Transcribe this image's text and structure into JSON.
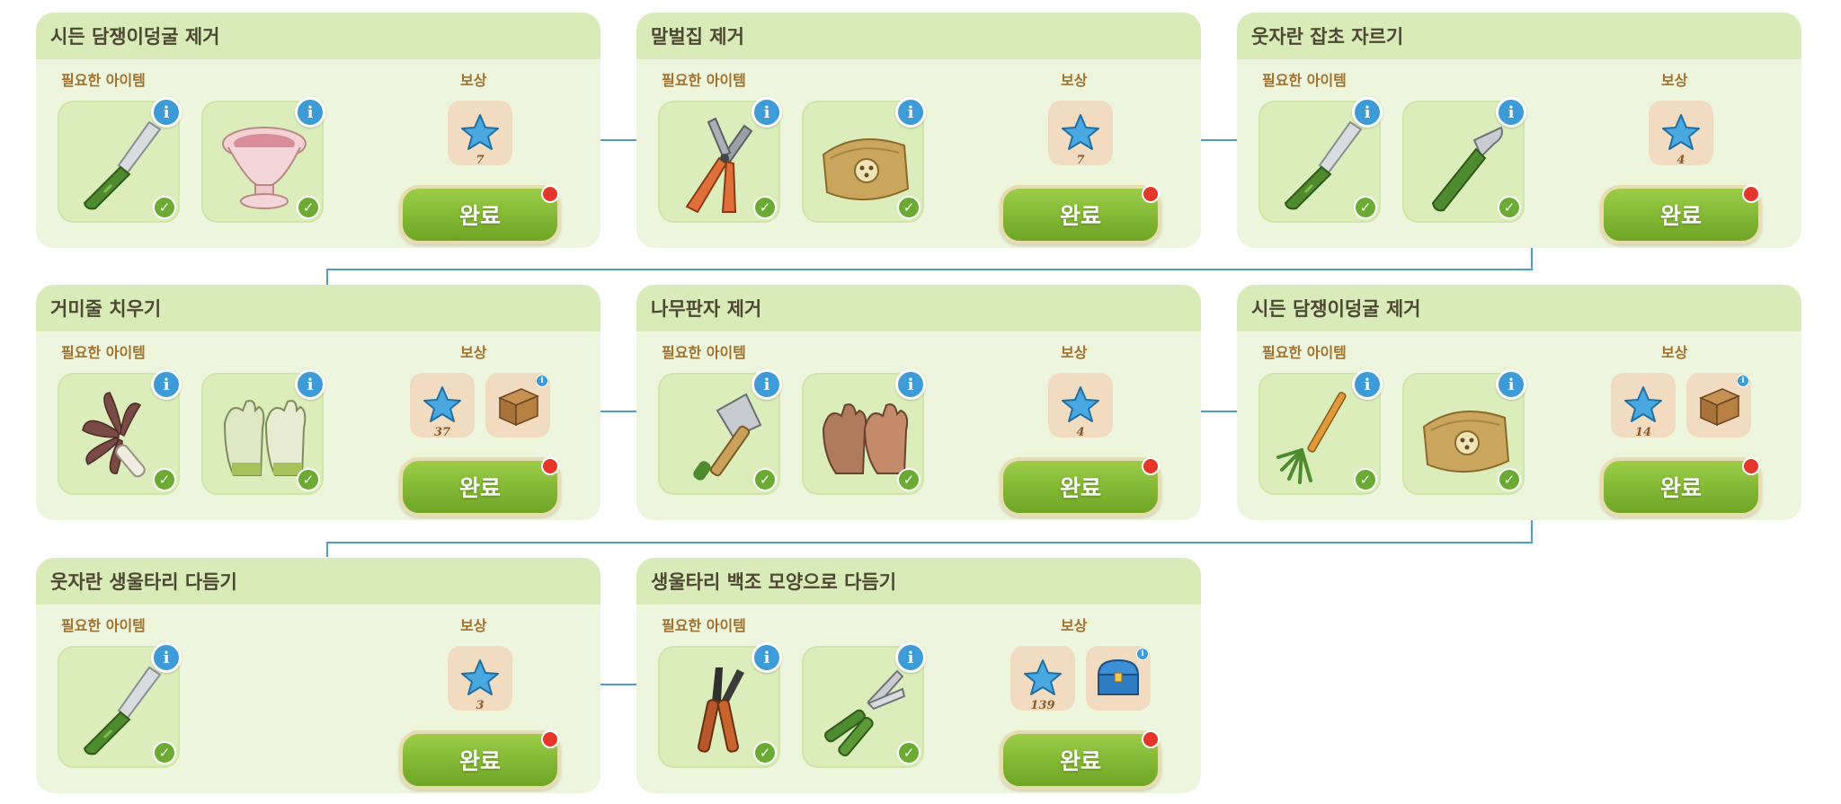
{
  "labels": {
    "required_items": "필요한 아이템",
    "reward": "보상",
    "complete_button": "완료",
    "info_symbol": "i",
    "check_symbol": "✓"
  },
  "colors": {
    "card_background": "#eef5dd",
    "card_header": "#d9ebb8",
    "button_green": "#7fb832",
    "notification_red": "#e5362a",
    "info_blue": "#3d9bd8",
    "connector_blue": "#4f9ccf"
  },
  "tasks": [
    {
      "title": "시든 담쟁이덩굴 제거",
      "items": [
        {
          "icon": "knife-icon"
        },
        {
          "icon": "pink-vase-icon"
        }
      ],
      "rewards": [
        {
          "icon": "blue-star-icon",
          "count": "7"
        }
      ]
    },
    {
      "title": "말벌집 제거",
      "items": [
        {
          "icon": "pliers-icon"
        },
        {
          "icon": "cloth-bag-icon"
        }
      ],
      "rewards": [
        {
          "icon": "blue-star-icon",
          "count": "7"
        }
      ]
    },
    {
      "title": "웃자란 잡초 자르기",
      "items": [
        {
          "icon": "knife-icon"
        },
        {
          "icon": "hook-knife-icon"
        }
      ],
      "rewards": [
        {
          "icon": "blue-star-icon",
          "count": "4"
        }
      ]
    },
    {
      "title": "거미줄 치우기",
      "items": [
        {
          "icon": "feather-duster-icon"
        },
        {
          "icon": "garden-gloves-icon"
        }
      ],
      "rewards": [
        {
          "icon": "blue-star-icon",
          "count": "37"
        },
        {
          "icon": "wooden-crate-icon",
          "count": ""
        }
      ]
    },
    {
      "title": "나무판자 제거",
      "items": [
        {
          "icon": "axe-icon"
        },
        {
          "icon": "work-gloves-icon"
        }
      ],
      "rewards": [
        {
          "icon": "blue-star-icon",
          "count": "4"
        }
      ]
    },
    {
      "title": "시든 담쟁이덩굴 제거",
      "items": [
        {
          "icon": "rake-icon"
        },
        {
          "icon": "cloth-bag-icon"
        }
      ],
      "rewards": [
        {
          "icon": "blue-star-icon",
          "count": "14"
        },
        {
          "icon": "wooden-crate-icon",
          "count": ""
        }
      ]
    },
    {
      "title": "웃자란 생울타리 다듬기",
      "items": [
        {
          "icon": "knife-icon"
        }
      ],
      "rewards": [
        {
          "icon": "blue-star-icon",
          "count": "3"
        }
      ]
    },
    {
      "title": "생울타리 백조 모양으로 다듬기",
      "items": [
        {
          "icon": "loppers-icon"
        },
        {
          "icon": "pruning-shears-icon"
        }
      ],
      "rewards": [
        {
          "icon": "blue-star-icon",
          "count": "139"
        },
        {
          "icon": "treasure-chest-icon",
          "count": ""
        }
      ]
    }
  ]
}
